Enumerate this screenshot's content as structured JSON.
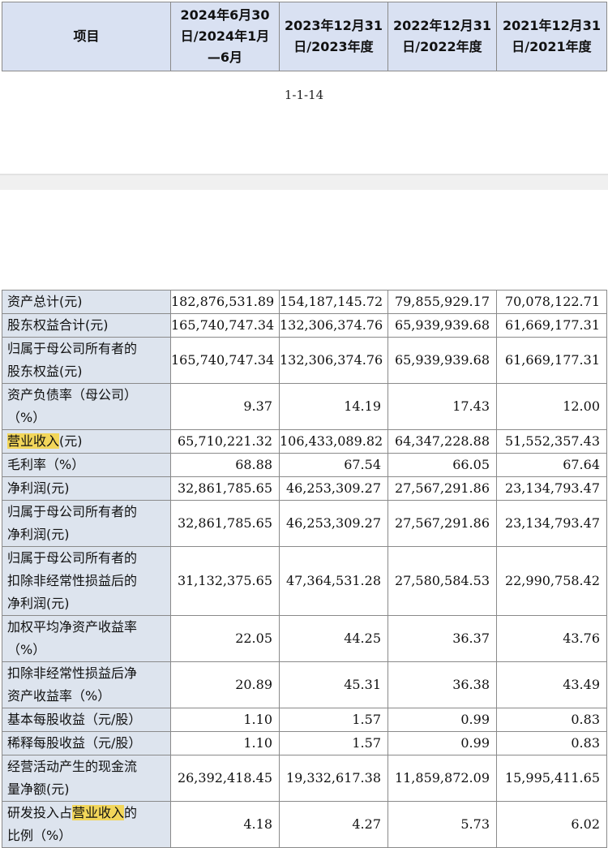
{
  "header": {
    "item": "项目",
    "periods": [
      [
        "2024年6月30",
        "日/2024年1月",
        "—6月"
      ],
      [
        "2023年12月31",
        "日/2023年度"
      ],
      [
        "2022年12月31",
        "日/2022年度"
      ],
      [
        "2021年12月31",
        "日/2021年度"
      ]
    ]
  },
  "page_number": "1-1-14",
  "rows": [
    {
      "label": [
        "资产总计(元)"
      ],
      "values": [
        "182,876,531.89",
        "154,187,145.72",
        "79,855,929.17",
        "70,078,122.71"
      ]
    },
    {
      "label": [
        "股东权益合计(元)"
      ],
      "values": [
        "165,740,747.34",
        "132,306,374.76",
        "65,939,939.68",
        "61,669,177.31"
      ]
    },
    {
      "label": [
        "归属于母公司所有者的",
        "股东权益(元)"
      ],
      "values": [
        "165,740,747.34",
        "132,306,374.76",
        "65,939,939.68",
        "61,669,177.31"
      ]
    },
    {
      "label": [
        "资产负债率（母公司）",
        "（%）"
      ],
      "values": [
        "9.37",
        "14.19",
        "17.43",
        "12.00"
      ]
    },
    {
      "label": [
        "营业收入(元)"
      ],
      "highlight": "营业收入",
      "values": [
        "65,710,221.32",
        "106,433,089.82",
        "64,347,228.88",
        "51,552,357.43"
      ]
    },
    {
      "label": [
        "毛利率（%）"
      ],
      "values": [
        "68.88",
        "67.54",
        "66.05",
        "67.64"
      ]
    },
    {
      "label": [
        "净利润(元)"
      ],
      "values": [
        "32,861,785.65",
        "46,253,309.27",
        "27,567,291.86",
        "23,134,793.47"
      ]
    },
    {
      "label": [
        "归属于母公司所有者的",
        "净利润(元)"
      ],
      "values": [
        "32,861,785.65",
        "46,253,309.27",
        "27,567,291.86",
        "23,134,793.47"
      ]
    },
    {
      "label": [
        "归属于母公司所有者的",
        "扣除非经常性损益后的",
        "净利润(元)"
      ],
      "values": [
        "31,132,375.65",
        "47,364,531.28",
        "27,580,584.53",
        "22,990,758.42"
      ]
    },
    {
      "label": [
        "加权平均净资产收益率",
        "（%）"
      ],
      "values": [
        "22.05",
        "44.25",
        "36.37",
        "43.76"
      ]
    },
    {
      "label": [
        "扣除非经常性损益后净",
        "资产收益率（%）"
      ],
      "values": [
        "20.89",
        "45.31",
        "36.38",
        "43.49"
      ]
    },
    {
      "label": [
        "基本每股收益（元/股）"
      ],
      "values": [
        "1.10",
        "1.57",
        "0.99",
        "0.83"
      ]
    },
    {
      "label": [
        "稀释每股收益（元/股）"
      ],
      "values": [
        "1.10",
        "1.57",
        "0.99",
        "0.83"
      ]
    },
    {
      "label": [
        "经营活动产生的现金流",
        "量净额(元)"
      ],
      "values": [
        "26,392,418.45",
        "19,332,617.38",
        "11,859,872.09",
        "15,995,411.65"
      ]
    },
    {
      "label": [
        "研发投入占营业收入的",
        "比例（%）"
      ],
      "highlight": "营业收入",
      "values": [
        "4.18",
        "4.27",
        "5.73",
        "6.02"
      ]
    }
  ]
}
